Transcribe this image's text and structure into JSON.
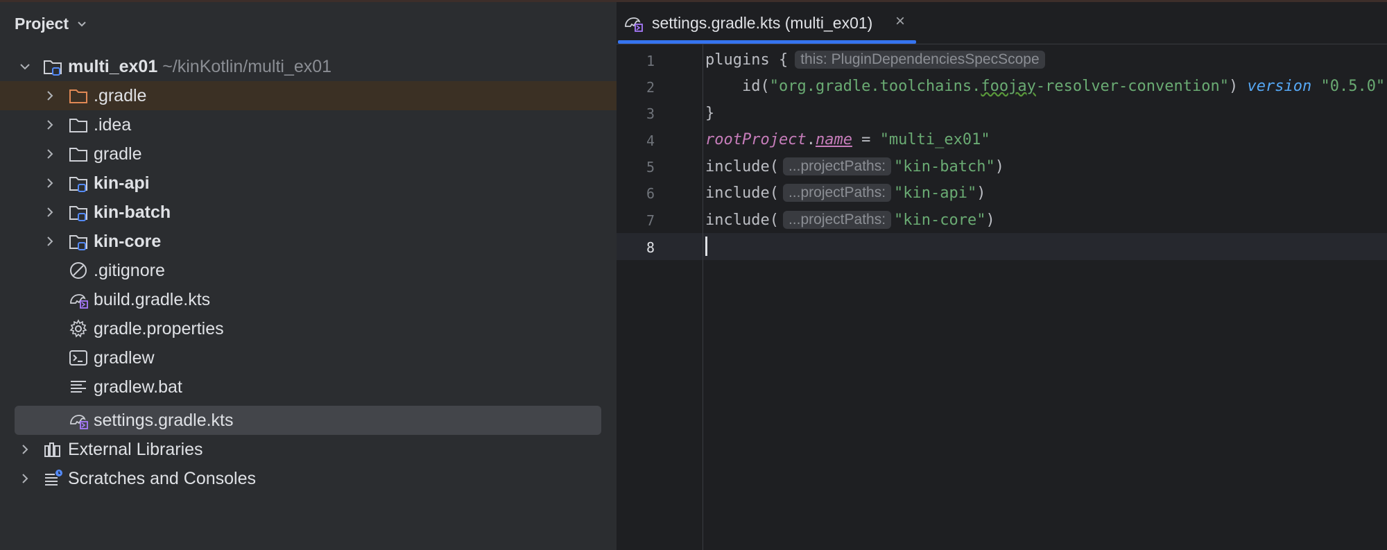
{
  "project_panel": {
    "title": "Project",
    "tree": [
      {
        "label": "multi_ex01",
        "path": "~/kinKotlin/multi_ex01",
        "icon": "module-folder-icon",
        "expanded": true
      },
      {
        "label": ".gradle",
        "icon": "folder-orange-icon"
      },
      {
        "label": ".idea",
        "icon": "folder-icon"
      },
      {
        "label": "gradle",
        "icon": "folder-icon"
      },
      {
        "label": "kin-api",
        "icon": "module-folder-icon"
      },
      {
        "label": "kin-batch",
        "icon": "module-folder-icon"
      },
      {
        "label": "kin-core",
        "icon": "module-folder-icon"
      },
      {
        "label": ".gitignore",
        "icon": "gitignore-icon"
      },
      {
        "label": "build.gradle.kts",
        "icon": "gradle-kotlin-icon"
      },
      {
        "label": "gradle.properties",
        "icon": "gear-icon"
      },
      {
        "label": "gradlew",
        "icon": "terminal-icon"
      },
      {
        "label": "gradlew.bat",
        "icon": "text-file-icon"
      },
      {
        "label": "settings.gradle.kts",
        "icon": "gradle-kotlin-icon",
        "selected": true
      },
      {
        "label": "External Libraries",
        "icon": "libraries-icon"
      },
      {
        "label": "Scratches and Consoles",
        "icon": "scratches-icon"
      }
    ]
  },
  "editor": {
    "tab_label": "settings.gradle.kts (multi_ex01)",
    "tab_close": "×",
    "accent": "#3574f0",
    "line_numbers": [
      "1",
      "2",
      "3",
      "4",
      "5",
      "6",
      "7",
      "8"
    ],
    "code": {
      "l1_plugins": "plugins {",
      "l1_hint": "this: PluginDependenciesSpecScope",
      "l2_id": "    id(",
      "l2_str_a": "\"org.gradle.toolchains.",
      "l2_str_b": "foojay",
      "l2_str_c": "-resolver-convention\"",
      "l2_close": ") ",
      "l2_version": "version",
      "l2_ver_str": " \"0.5.0\"",
      "l3": "}",
      "l4_root": "rootProject",
      "l4_dot": ".",
      "l4_name": "name",
      "l4_eq": " = ",
      "l4_str": "\"multi_ex01\"",
      "include": "include(",
      "hint_paths": "...projectPaths:",
      "l5_str": "\"kin-batch\"",
      "l6_str": "\"kin-api\"",
      "l7_str": "\"kin-core\"",
      "close_paren": ")"
    }
  }
}
